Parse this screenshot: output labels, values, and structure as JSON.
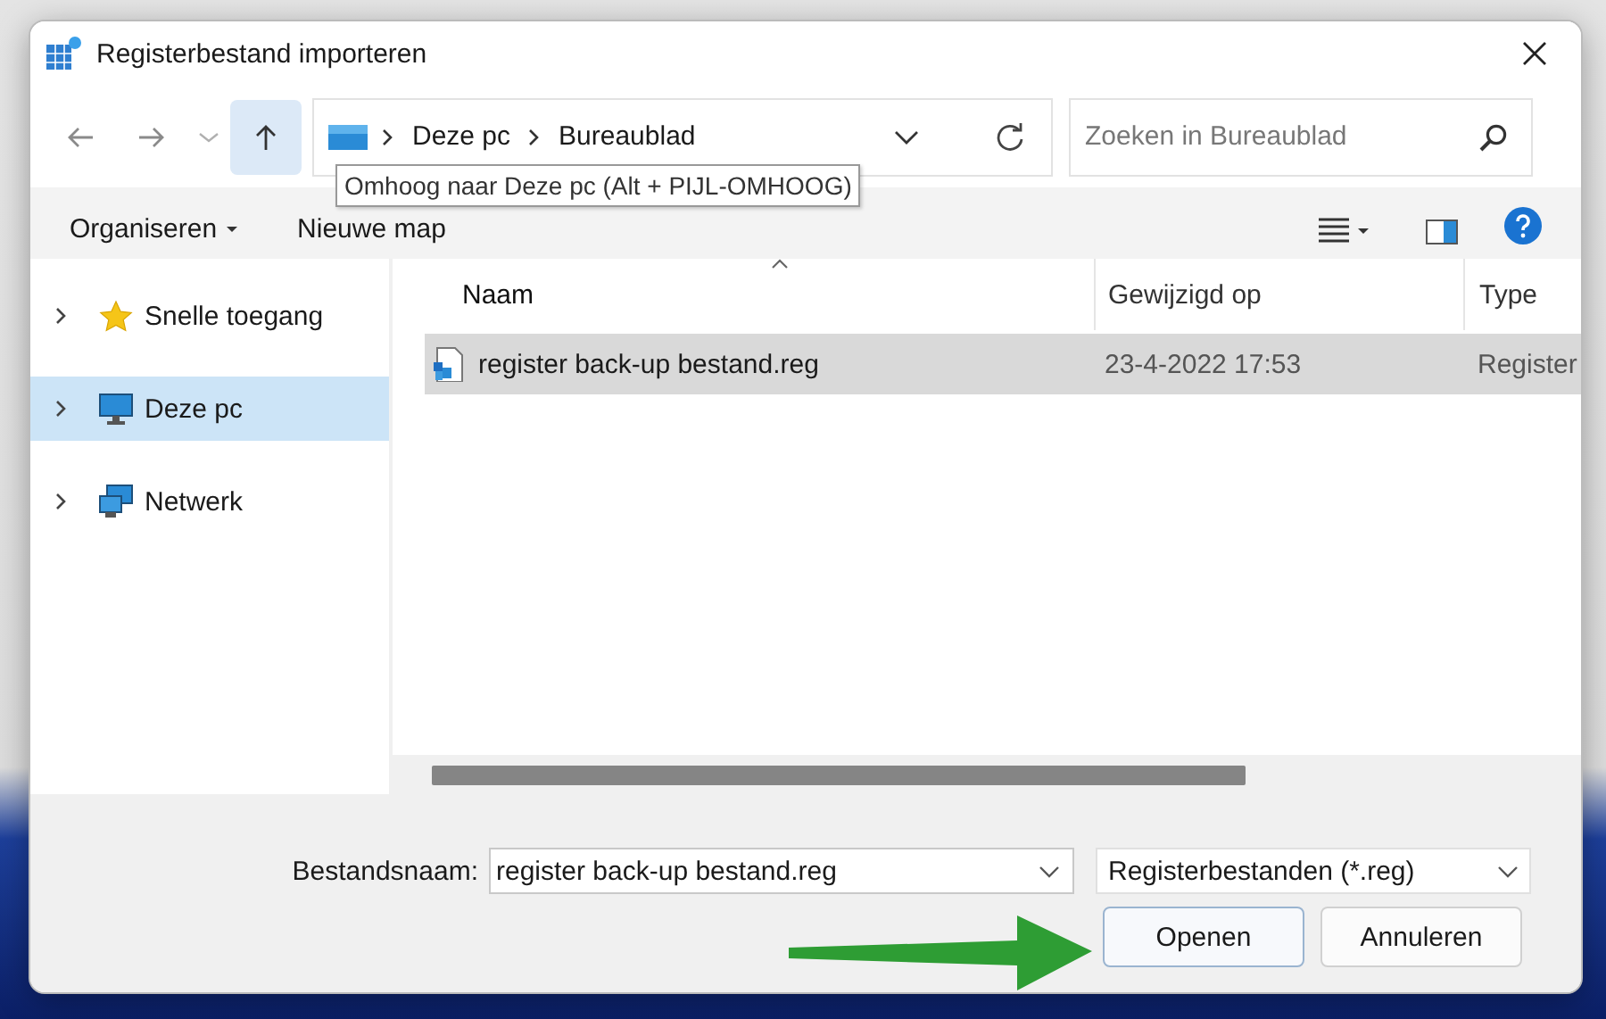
{
  "window": {
    "title": "Registerbestand importeren"
  },
  "navigation": {
    "buttons": [
      {
        "kind": "back",
        "highlighted": false
      },
      {
        "kind": "forward",
        "highlighted": false
      },
      {
        "kind": "recent",
        "highlighted": false
      },
      {
        "kind": "up",
        "highlighted": true
      }
    ],
    "address": [
      "Deze pc",
      "Bureaublad"
    ],
    "search": {
      "placeholder": "Zoeken in Bureaublad"
    }
  },
  "tooltip": "Omhoog naar Deze pc (Alt + PIJL-OMHOOG)",
  "commands": [
    {
      "label": "Organiseren",
      "has_menu": true
    },
    {
      "label": "Nieuwe map",
      "has_menu": false
    }
  ],
  "sidebar": {
    "items": [
      {
        "label": "Snelle toegang",
        "kind": "star",
        "selected": false
      },
      {
        "label": "Deze pc",
        "kind": "pc",
        "selected": true
      },
      {
        "label": "Netwerk",
        "kind": "network",
        "selected": false
      }
    ]
  },
  "table": {
    "columns": [
      {
        "label": "Naam",
        "sorted": true
      },
      {
        "label": "Gewijzigd op",
        "sorted": false
      },
      {
        "label": "Type",
        "sorted": false
      }
    ],
    "rows": [
      {
        "name": "register back-up bestand.reg",
        "modified": "23-4-2022 17:53",
        "type": "Register",
        "selected": true
      }
    ]
  },
  "footer": {
    "filename_label": "Bestandsnaam:",
    "filename": "register back-up bestand.reg",
    "filter": "Registerbestanden (*.reg)",
    "buttons": [
      {
        "label": "Openen",
        "default": true
      },
      {
        "label": "Annuleren",
        "default": false
      }
    ]
  }
}
